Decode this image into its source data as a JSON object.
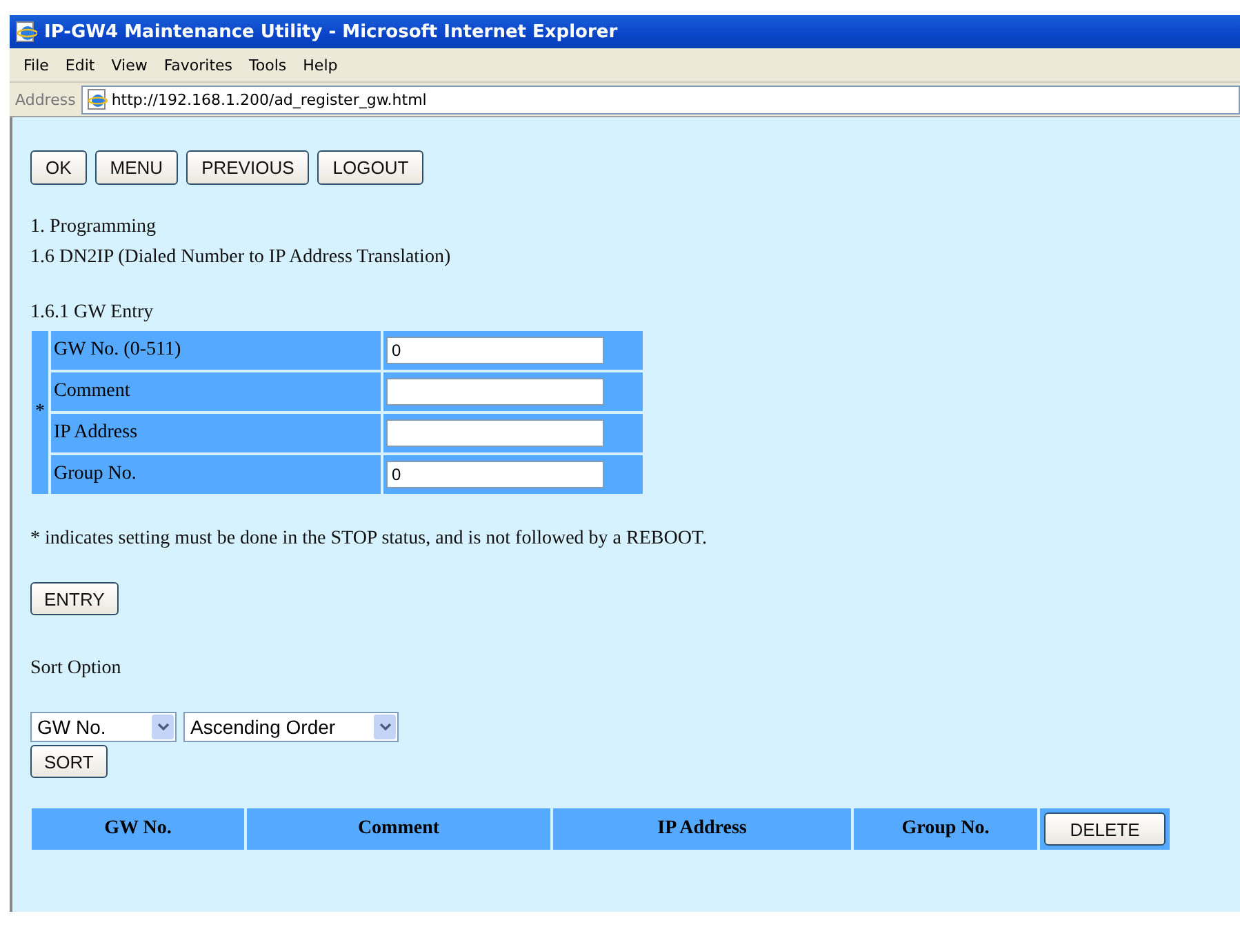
{
  "window": {
    "title": "IP-GW4 Maintenance Utility - Microsoft Internet Explorer"
  },
  "menu": [
    "File",
    "Edit",
    "View",
    "Favorites",
    "Tools",
    "Help"
  ],
  "address_bar": {
    "label": "Address",
    "url": "http://192.168.1.200/ad_register_gw.html"
  },
  "top_buttons": [
    "OK",
    "MENU",
    "PREVIOUS",
    "LOGOUT"
  ],
  "breadcrumb": [
    "1. Programming",
    "1.6 DN2IP (Dialed Number to IP Address Translation)"
  ],
  "section_title": "1.6.1 GW Entry",
  "form": {
    "marker": "*",
    "fields": [
      {
        "label": "GW No. (0-511)",
        "value": "0"
      },
      {
        "label": "Comment"
      },
      {
        "label": "IP Address"
      },
      {
        "label": "Group No.",
        "value": "0"
      }
    ]
  },
  "note": "* indicates setting must be done in the STOP status, and is not followed by a REBOOT.",
  "entry_button": "ENTRY",
  "sort": {
    "label": "Sort Option",
    "selects": [
      "GW No.",
      "Ascending Order"
    ],
    "button": "SORT"
  },
  "table": {
    "columns": [
      "GW No.",
      "Comment",
      "IP Address",
      "Group No."
    ],
    "delete_button": "DELETE"
  }
}
